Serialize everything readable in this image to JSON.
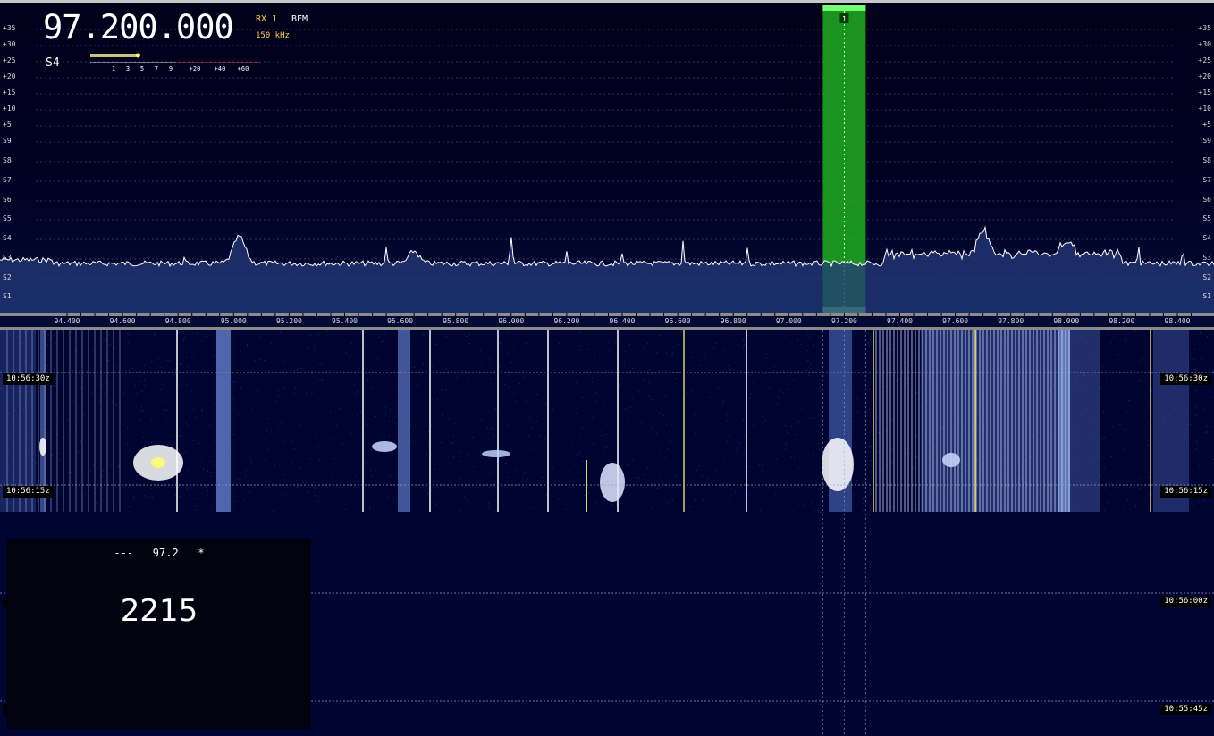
{
  "frequency": "97.200.000",
  "receiver": {
    "label": "RX 1",
    "mode": "BFM",
    "bandwidth": "150 kHz"
  },
  "smeter": {
    "value": "S4",
    "level": 0.27,
    "scale": [
      "1",
      "3",
      "5",
      "7",
      "9",
      "+20",
      "+40",
      "+60"
    ]
  },
  "db_scale": [
    "+35",
    "+30",
    "+25",
    "+20",
    "+15",
    "+10",
    "+5",
    "S9",
    "S8",
    "S7",
    "S6",
    "S5",
    "S4",
    "S3",
    "S2",
    "S1"
  ],
  "freq_scale": [
    "94.400",
    "94.600",
    "94.800",
    "95.000",
    "95.200",
    "95.400",
    "95.600",
    "95.800",
    "96.000",
    "96.200",
    "96.400",
    "96.600",
    "96.800",
    "97.000",
    "97.200",
    "97.400",
    "97.600",
    "97.800",
    "98.000",
    "98.200",
    "98.400"
  ],
  "vfo_marker": "1",
  "waterfall_times": [
    "10:56:30z",
    "10:56:15z",
    "10:56:00z",
    "10:55:45z"
  ],
  "rds": {
    "line": "---   97.2   *",
    "pi": "2215"
  },
  "colors": {
    "accent": "#ffd24b",
    "vfo": "#1fbf1f",
    "waterfall_bg": "#000430",
    "trace": "#ffffff"
  }
}
